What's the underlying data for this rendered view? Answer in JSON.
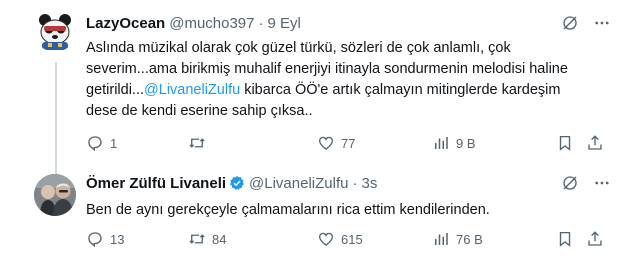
{
  "tweets": [
    {
      "name": "LazyOcean",
      "handle": "@mucho397",
      "separator": "·",
      "time": "9 Eyl",
      "text_lines": [
        "Aslında müzikal olarak çok güzel türkü, sözleri de çok anlamlı, çok",
        "severim...ama birikmiş muhalif enerjiyi itinayla sondurmenin melodisi haline"
      ],
      "line3_before": "getirildi...",
      "mention": "@LivaneliZulfu",
      "line3_after": " kibarca ÖÖ'e artık çalmayın mitinglerde kardeşim",
      "line4": "dese de kendi eserine sahip çıksa..",
      "replies": "1",
      "retweets": "",
      "likes": "77",
      "views": "9 B"
    },
    {
      "name": "Ömer Zülfü Livaneli",
      "handle": "@LivaneliZulfu",
      "separator": "·",
      "time": "3s",
      "text": "Ben de aynı gerekçeyle çalmamalarını rica ettim kendilerinden.",
      "replies": "13",
      "retweets": "84",
      "likes": "615",
      "views": "76 B"
    }
  ],
  "icons": {
    "reply": "reply-icon",
    "retweet": "retweet-icon",
    "like": "heart-icon",
    "views": "views-icon",
    "bookmark": "bookmark-icon",
    "share": "share-icon",
    "grok": "grok-icon",
    "more": "more-icon",
    "verified": "verified-badge-icon"
  },
  "colors": {
    "text": "#0f1419",
    "muted": "#536471",
    "link": "#1d9bf0",
    "verified": "#1d9bf0",
    "thread_line": "#cfd9de"
  }
}
